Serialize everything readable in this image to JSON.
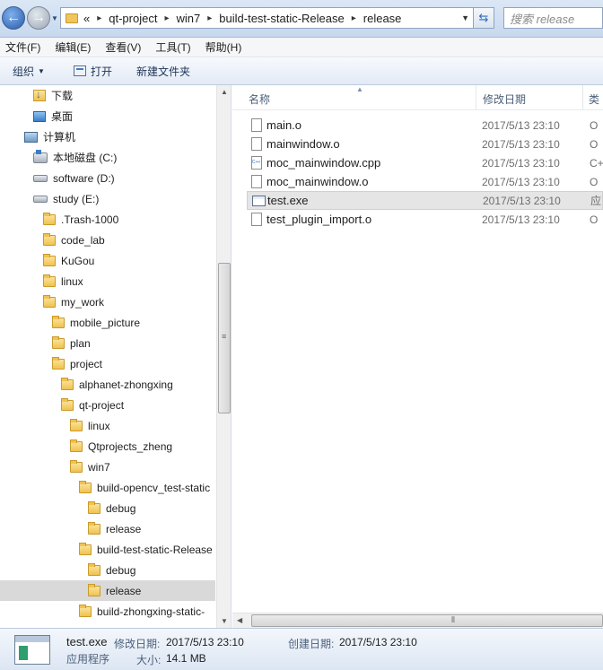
{
  "address": {
    "prefix": "«",
    "crumbs": [
      "qt-project",
      "win7",
      "build-test-static-Release",
      "release"
    ],
    "separator": "▸",
    "search_placeholder": "搜索 release"
  },
  "menu": [
    "文件(F)",
    "编辑(E)",
    "查看(V)",
    "工具(T)",
    "帮助(H)"
  ],
  "toolbar": {
    "organize": "组织",
    "open": "打开",
    "new_folder": "新建文件夹"
  },
  "tree": [
    {
      "label": "下载",
      "icon": "download-icon"
    },
    {
      "label": "桌面",
      "icon": "desktop-icon"
    },
    {
      "label": "计算机",
      "icon": "computer-icon"
    },
    {
      "label": "本地磁盘 (C:)",
      "icon": "system-drive-icon"
    },
    {
      "label": "software (D:)",
      "icon": "drive-icon"
    },
    {
      "label": "study (E:)",
      "icon": "drive-icon"
    },
    {
      "label": ".Trash-1000",
      "icon": "folder-icon"
    },
    {
      "label": "code_lab",
      "icon": "folder-icon"
    },
    {
      "label": "KuGou",
      "icon": "folder-icon"
    },
    {
      "label": "linux",
      "icon": "folder-icon"
    },
    {
      "label": "my_work",
      "icon": "folder-icon"
    },
    {
      "label": "mobile_picture",
      "icon": "folder-icon"
    },
    {
      "label": "plan",
      "icon": "folder-icon"
    },
    {
      "label": "project",
      "icon": "folder-icon"
    },
    {
      "label": "alphanet-zhongxing",
      "icon": "folder-icon"
    },
    {
      "label": "qt-project",
      "icon": "folder-icon"
    },
    {
      "label": "linux",
      "icon": "folder-icon"
    },
    {
      "label": "Qtprojects_zheng",
      "icon": "folder-icon"
    },
    {
      "label": "win7",
      "icon": "folder-icon"
    },
    {
      "label": "build-opencv_test-static",
      "icon": "folder-icon"
    },
    {
      "label": "debug",
      "icon": "folder-icon"
    },
    {
      "label": "release",
      "icon": "folder-icon"
    },
    {
      "label": "build-test-static-Release",
      "icon": "folder-icon"
    },
    {
      "label": "debug",
      "icon": "folder-icon"
    },
    {
      "label": "release",
      "icon": "folder-icon"
    },
    {
      "label": "build-zhongxing-static-",
      "icon": "folder-icon"
    }
  ],
  "columns": {
    "name": "名称",
    "date": "修改日期",
    "type": "类"
  },
  "files": [
    {
      "name": "main.o",
      "date": "2017/5/13 23:10",
      "type": "O",
      "icon": "file-icon"
    },
    {
      "name": "mainwindow.o",
      "date": "2017/5/13 23:10",
      "type": "O",
      "icon": "file-icon"
    },
    {
      "name": "moc_mainwindow.cpp",
      "date": "2017/5/13 23:10",
      "type": "C+",
      "icon": "cpp-file-icon"
    },
    {
      "name": "moc_mainwindow.o",
      "date": "2017/5/13 23:10",
      "type": "O",
      "icon": "file-icon"
    },
    {
      "name": "test.exe",
      "date": "2017/5/13 23:10",
      "type": "应",
      "icon": "exe-file-icon"
    },
    {
      "name": "test_plugin_import.o",
      "date": "2017/5/13 23:10",
      "type": "O",
      "icon": "file-icon"
    }
  ],
  "details": {
    "name": "test.exe",
    "type": "应用程序",
    "modified_label": "修改日期:",
    "modified": "2017/5/13 23:10",
    "created_label": "创建日期:",
    "created": "2017/5/13 23:10",
    "size_label": "大小:",
    "size": "14.1 MB"
  }
}
